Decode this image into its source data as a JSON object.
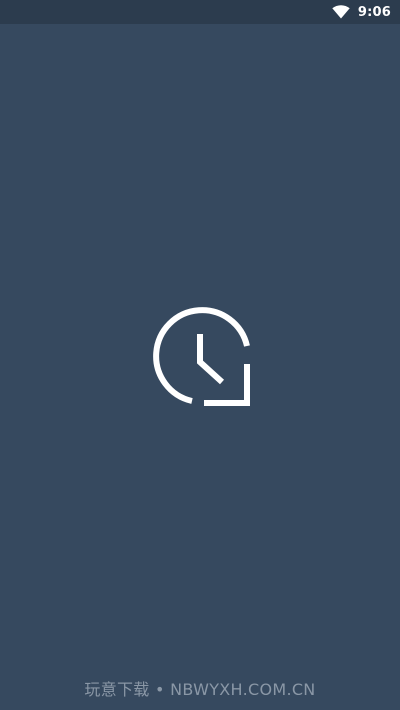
{
  "status_bar": {
    "time": "9:06",
    "wifi_icon": "wifi-icon"
  },
  "splash": {
    "logo_icon": "clock-icon"
  },
  "watermark": {
    "text": "玩意下载 • NBWYXH.COM.CN"
  },
  "colors": {
    "background": "#36495f",
    "status_bar": "#2c3c4e",
    "foreground": "#ffffff",
    "watermark": "#8a97a6"
  }
}
